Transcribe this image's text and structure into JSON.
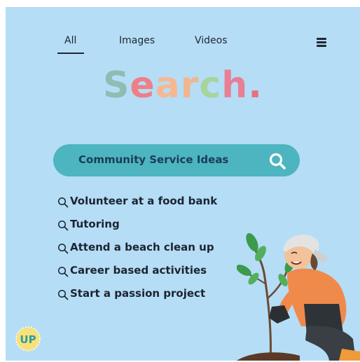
{
  "tabs": {
    "all": "All",
    "images": "Images",
    "videos": "Videos"
  },
  "title": {
    "letters": [
      "S",
      "e",
      "a",
      "r",
      "c",
      "h",
      "."
    ],
    "colors": [
      "#8fbcb3",
      "#ee7f88",
      "#f6b891",
      "#f1b590",
      "#a7d49d",
      "#e87f93",
      "#e8717e"
    ]
  },
  "search": {
    "query": "Community Service Ideas",
    "bar_color": "#4db5bf"
  },
  "suggestions": [
    "Volunteer at a food bank",
    "Tutoring",
    "Attend a beach clean up",
    "Career based activities",
    "Start a passion project"
  ],
  "logo": {
    "text": "UP"
  },
  "colors": {
    "background": "#b5ddf6",
    "text": "#1f2733"
  },
  "icons": {
    "menu": "hamburger-menu-icon",
    "search": "magnifier-icon",
    "suggestion": "magnifier-icon"
  }
}
